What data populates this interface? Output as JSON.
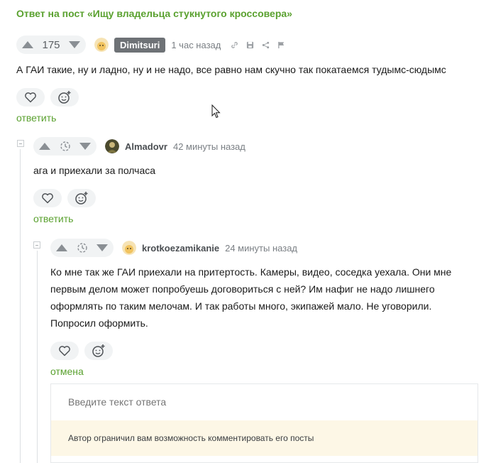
{
  "post_link": "Ответ на пост «Ищу владельца стукнутого кроссовера»",
  "comments": [
    {
      "rating": "175",
      "author": "Dimitsuri",
      "time": "1 час назад",
      "text": "А ГАИ такие, ну и ладно, ну и не надо, все равно нам скучно так покатаемся тудымс-сюдымс",
      "reply_label": "ответить"
    },
    {
      "author": "Almadovr",
      "time": "42 минуты назад",
      "text": "ага и приехали за полчаса",
      "reply_label": "ответить"
    },
    {
      "author": "krotkoezamikanie",
      "time": "24 минуты назад",
      "text_lines": [
        "Ко мне так же ГАИ приехали на притертость. Камеры, видео, соседка уехала. Они мне",
        "первым делом может попробуешь договориться с ней? Им нафиг не надо лишнего",
        "оформлять по таким мелочам. И так работы много, экипажей мало. Не уговорили.",
        "Попросил оформить."
      ],
      "cancel_label": "отмена"
    }
  ],
  "reply_form": {
    "placeholder": "Введите текст ответа",
    "restriction_notice": "Автор ограничил вам возможность комментировать его посты"
  },
  "colors": {
    "accent_green": "#5aa12f",
    "badge_gray": "#6e7276",
    "notice_bg": "#fdf7e6"
  }
}
